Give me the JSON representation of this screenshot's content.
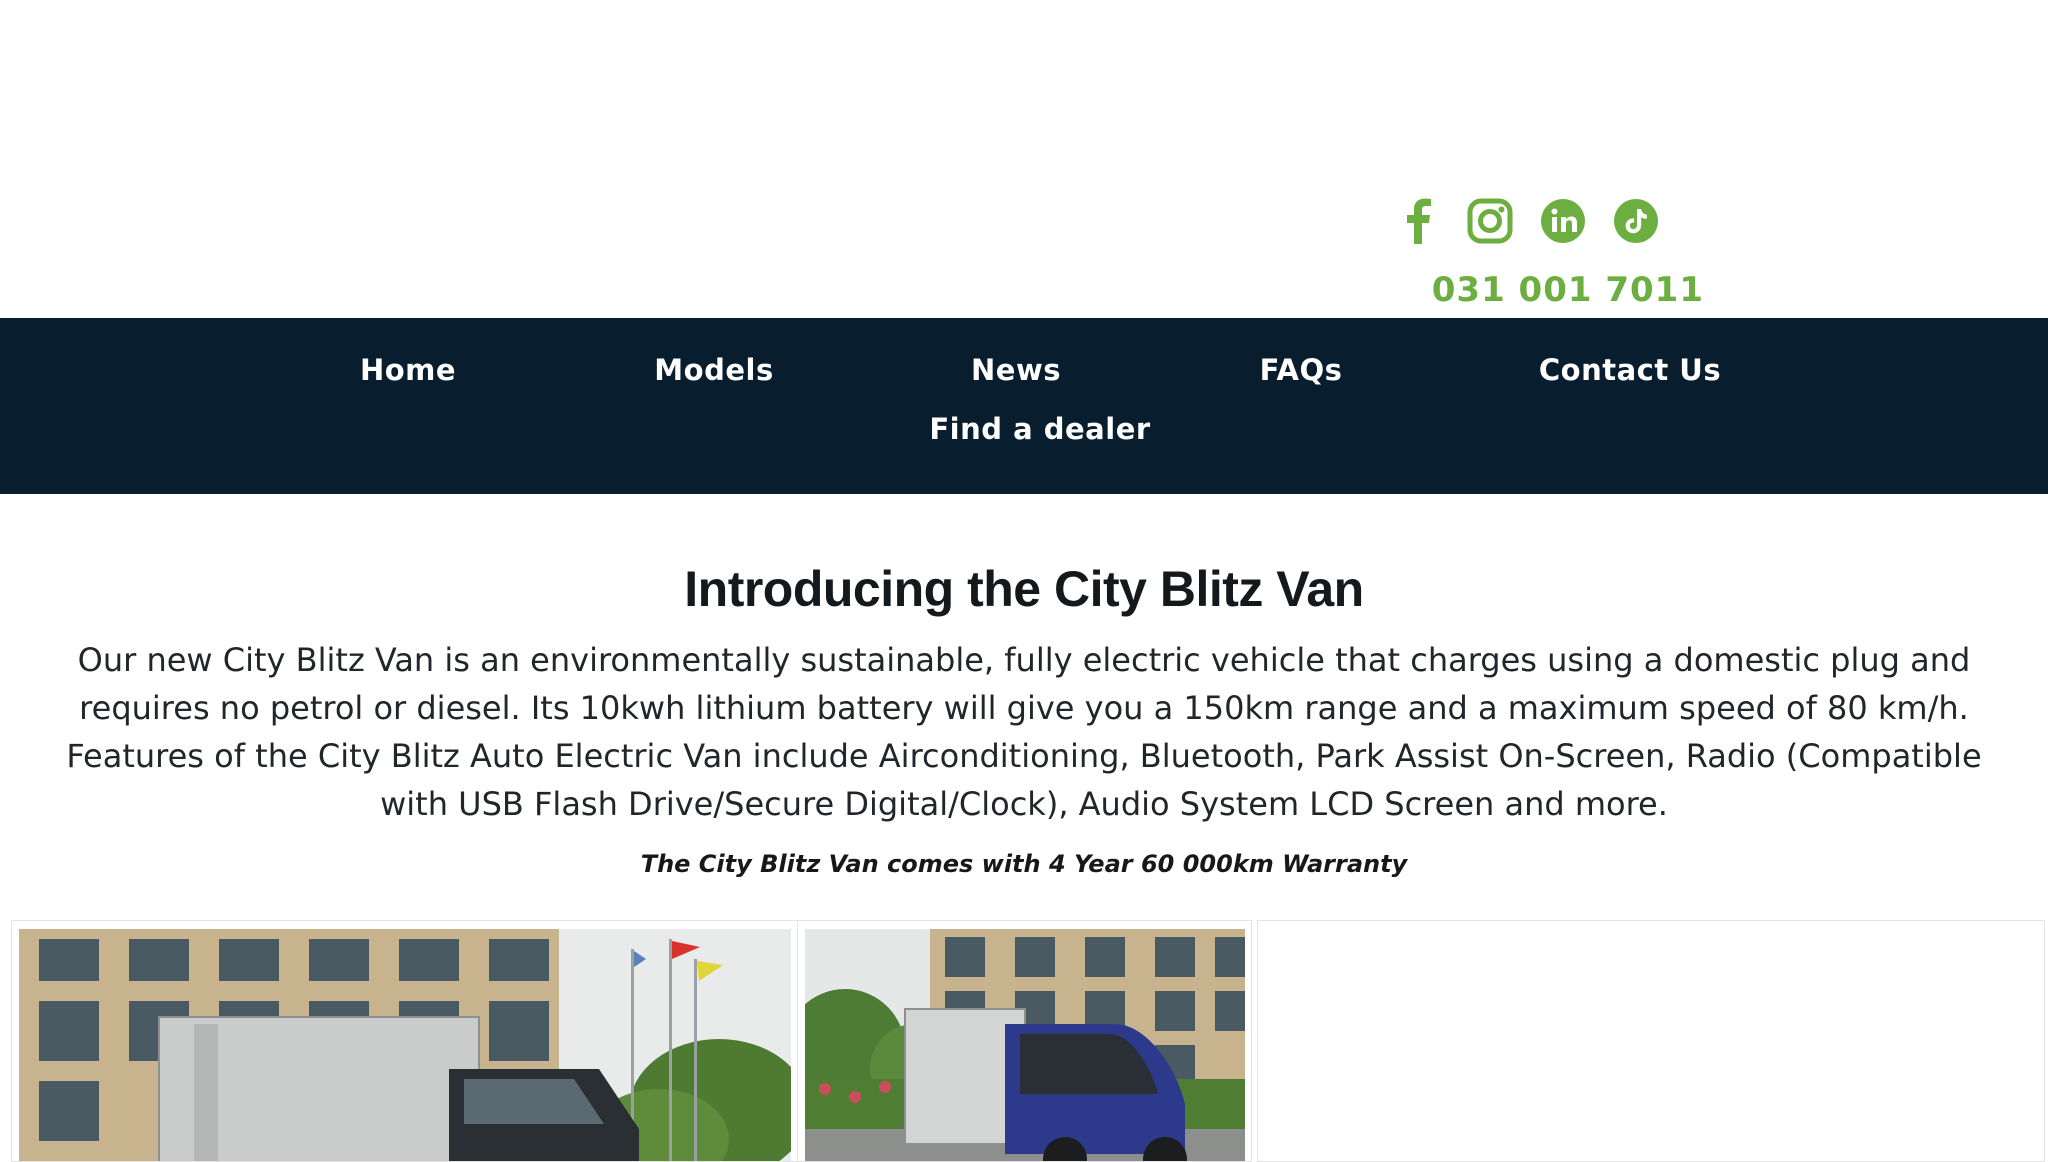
{
  "header": {
    "social": [
      {
        "icon": "facebook-icon",
        "label": "Facebook"
      },
      {
        "icon": "instagram-icon",
        "label": "Instagram"
      },
      {
        "icon": "linkedin-icon",
        "label": "LinkedIn"
      },
      {
        "icon": "tiktok-icon",
        "label": "TikTok"
      }
    ],
    "phone": "031 001 7011"
  },
  "nav": {
    "items": [
      {
        "label": "Home"
      },
      {
        "label": "Models"
      },
      {
        "label": "News"
      },
      {
        "label": "FAQs"
      },
      {
        "label": "Contact Us"
      },
      {
        "label": "Find a dealer"
      }
    ]
  },
  "main": {
    "title": "Introducing the City Blitz Van",
    "paragraph": "Our new City Blitz Van is an environmentally sustainable, fully electric vehicle that charges using a domestic plug and requires no petrol or diesel. Its 10kwh lithium battery will give you a 150km range and a maximum speed of 80 km/h. Features of the City Blitz Auto Electric Van include Airconditioning, Bluetooth, Park Assist On-Screen, Radio (Compatible with USB Flash Drive/Secure Digital/Clock), Audio System LCD Screen and more.",
    "warranty": "The City Blitz Van comes with 4 Year 60 000km Warranty"
  },
  "colors": {
    "accent_green": "#6cae3f",
    "nav_background": "#081e2e",
    "nav_text": "#ffffff"
  }
}
